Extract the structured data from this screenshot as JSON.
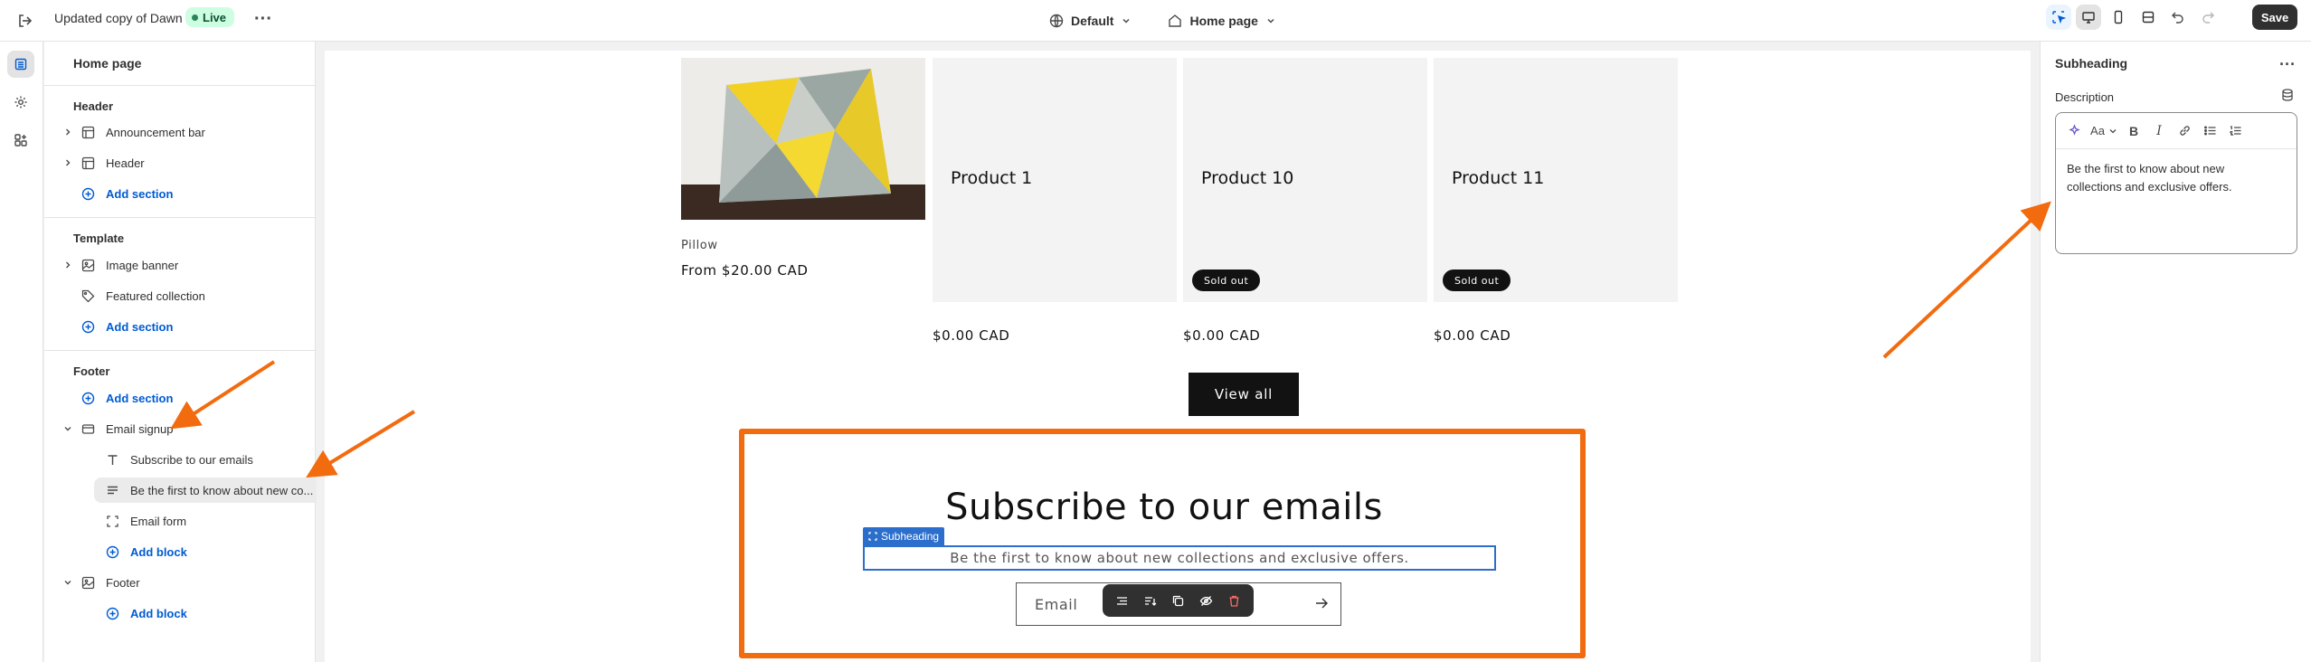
{
  "topbar": {
    "theme_name": "Updated copy of Dawn",
    "live_badge": "Live",
    "theme_selector": "Default",
    "page_selector": "Home page",
    "save_label": "Save"
  },
  "sidebar": {
    "title": "Home page",
    "groups": {
      "header": "Header",
      "template": "Template",
      "footer": "Footer"
    },
    "items": {
      "announcement_bar": "Announcement bar",
      "header": "Header",
      "add_section_1": "Add section",
      "image_banner": "Image banner",
      "featured_collection": "Featured collection",
      "add_section_2": "Add section",
      "add_section_3": "Add section",
      "email_signup": "Email signup",
      "subscribe_block": "Subscribe to our emails",
      "subheading_block": "Be the first to know about new co...",
      "email_form_block": "Email form",
      "add_block_1": "Add block",
      "footer": "Footer",
      "add_block_2": "Add block"
    }
  },
  "preview": {
    "products": [
      {
        "name": "Pillow",
        "price": "From $20.00 CAD"
      },
      {
        "name": "Product 1",
        "price": "$0.00 CAD"
      },
      {
        "name": "Product 10",
        "price": "$0.00 CAD",
        "badge": "Sold out"
      },
      {
        "name": "Product 11",
        "price": "$0.00 CAD",
        "badge": "Sold out"
      }
    ],
    "view_all": "View all",
    "signup": {
      "title": "Subscribe to our emails",
      "tag": "Subheading",
      "description": "Be the first to know about new collections and exclusive offers.",
      "email_placeholder": "Email"
    }
  },
  "settings": {
    "title": "Subheading",
    "field_label": "Description",
    "text": "Be the first to know about new collections and exclusive offers."
  },
  "colors": {
    "accent": "#005bd3",
    "annotation": "#f26b0f",
    "selection": "#2c6ecb",
    "live_bg": "#cdfee1"
  }
}
